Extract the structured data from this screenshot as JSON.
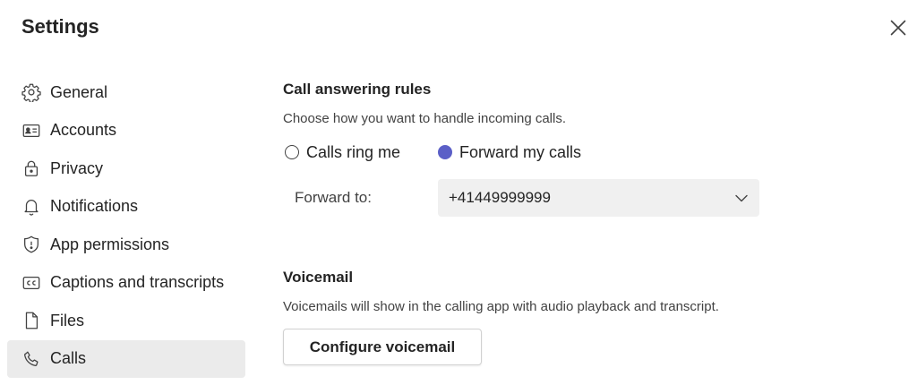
{
  "window": {
    "title": "Settings",
    "close_icon": "close-icon"
  },
  "sidebar": {
    "items": [
      {
        "label": "General",
        "icon": "gear-icon",
        "selected": false
      },
      {
        "label": "Accounts",
        "icon": "contact-card-icon",
        "selected": false
      },
      {
        "label": "Privacy",
        "icon": "lock-icon",
        "selected": false
      },
      {
        "label": "Notifications",
        "icon": "bell-icon",
        "selected": false
      },
      {
        "label": "App permissions",
        "icon": "shield-icon",
        "selected": false
      },
      {
        "label": "Captions and transcripts",
        "icon": "closed-captions-icon",
        "selected": false
      },
      {
        "label": "Files",
        "icon": "document-icon",
        "selected": false
      },
      {
        "label": "Calls",
        "icon": "phone-icon",
        "selected": true
      }
    ]
  },
  "call_answering": {
    "title": "Call answering rules",
    "description": "Choose how you want to handle incoming calls.",
    "options": [
      {
        "label": "Calls ring me",
        "checked": false
      },
      {
        "label": "Forward my calls",
        "checked": true
      }
    ],
    "forward_label": "Forward to:",
    "forward_value": "+41449999999"
  },
  "voicemail": {
    "title": "Voicemail",
    "description": "Voicemails will show in the calling app with audio playback and transcript.",
    "button_label": "Configure voicemail"
  },
  "colors": {
    "accent": "#5b5fc7",
    "selected_bg": "#ebebeb",
    "dropdown_bg": "#f0f0f0"
  }
}
